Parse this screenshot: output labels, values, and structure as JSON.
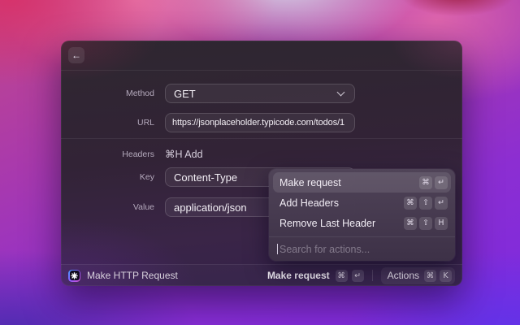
{
  "window": {
    "header": {
      "back_icon": "←"
    },
    "form": {
      "method": {
        "label": "Method",
        "value": "GET"
      },
      "url": {
        "label": "URL",
        "value": "https://jsonplaceholder.typicode.com/todos/1"
      },
      "headers": {
        "label": "Headers",
        "add_hint": "⌘H Add"
      },
      "key": {
        "label": "Key",
        "value": "Content-Type"
      },
      "value": {
        "label": "Value",
        "value": "application/json"
      }
    },
    "action_menu": {
      "items": [
        {
          "label": "Make request",
          "keys": [
            "⌘",
            "↵"
          ],
          "highlighted": true
        },
        {
          "label": "Add Headers",
          "keys": [
            "⌘",
            "⇧",
            "↵"
          ],
          "highlighted": false
        },
        {
          "label": "Remove Last Header",
          "keys": [
            "⌘",
            "⇧",
            "H"
          ],
          "highlighted": false
        }
      ],
      "search_placeholder": "Search for actions..."
    },
    "statusbar": {
      "app_name": "Make HTTP Request",
      "primary_action": {
        "label": "Make request",
        "keys": [
          "⌘",
          "↵"
        ]
      },
      "actions_button": {
        "label": "Actions",
        "keys": [
          "⌘",
          "K"
        ]
      }
    }
  },
  "colors": {
    "wallpaper_purple": "#8c2ed2",
    "wallpaper_pink": "#dd64ad",
    "wallpaper_red": "#d6336c",
    "window_bg": "#33243e",
    "popup_bg": "#4a3e54",
    "icon_border_gradient": [
      "#3fa2ff",
      "#8a5bff",
      "#d44fd0"
    ]
  }
}
